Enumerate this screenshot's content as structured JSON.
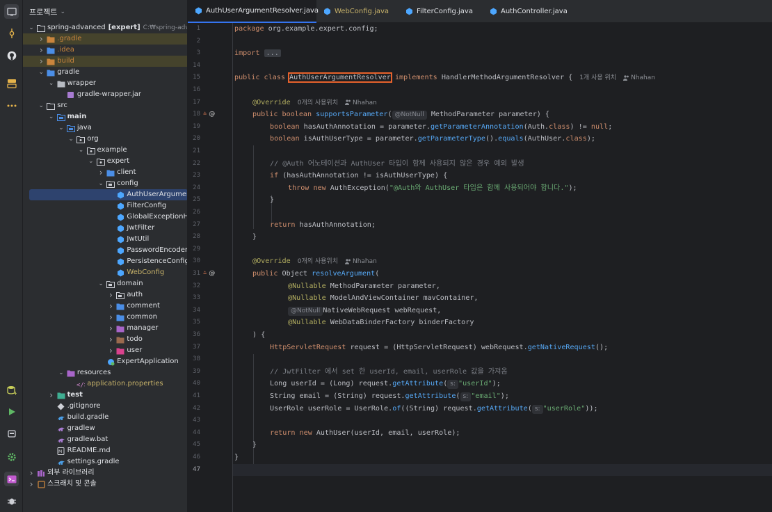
{
  "project_panel": {
    "title": "프로젝트",
    "chevron": "⌄"
  },
  "tree": [
    {
      "label": "spring-advanced",
      "bold_suffix": "[expert]",
      "extra": "C:₩spring-advanced"
    },
    {
      "label": ".gradle"
    },
    {
      "label": ".idea"
    },
    {
      "label": "build"
    },
    {
      "label": "gradle"
    },
    {
      "label": "wrapper"
    },
    {
      "label": "gradle-wrapper.jar"
    },
    {
      "label": "src"
    },
    {
      "label": "main"
    },
    {
      "label": "java"
    },
    {
      "label": "org"
    },
    {
      "label": "example"
    },
    {
      "label": "expert"
    },
    {
      "label": "client"
    },
    {
      "label": "config"
    },
    {
      "label": "AuthUserArgumentResolver"
    },
    {
      "label": "FilterConfig"
    },
    {
      "label": "GlobalExceptionHandler"
    },
    {
      "label": "JwtFilter"
    },
    {
      "label": "JwtUtil"
    },
    {
      "label": "PasswordEncoder"
    },
    {
      "label": "PersistenceConfig"
    },
    {
      "label": "WebConfig"
    },
    {
      "label": "domain"
    },
    {
      "label": "auth"
    },
    {
      "label": "comment"
    },
    {
      "label": "common"
    },
    {
      "label": "manager"
    },
    {
      "label": "todo"
    },
    {
      "label": "user"
    },
    {
      "label": "ExpertApplication"
    },
    {
      "label": "resources"
    },
    {
      "label": "application.properties"
    },
    {
      "label": "test"
    },
    {
      "label": ".gitignore"
    },
    {
      "label": "build.gradle"
    },
    {
      "label": "gradlew"
    },
    {
      "label": "gradlew.bat"
    },
    {
      "label": "README.md"
    },
    {
      "label": "settings.gradle"
    },
    {
      "label": "외부 라이브러리"
    },
    {
      "label": "스크래치 및 콘솔"
    }
  ],
  "tabs": [
    {
      "label": "AuthUserArgumentResolver.java",
      "close": "×"
    },
    {
      "label": "WebConfig.java"
    },
    {
      "label": "FilterConfig.java"
    },
    {
      "label": "AuthController.java"
    }
  ],
  "line_numbers": [
    "1",
    "2",
    "3",
    "14",
    "15",
    "16",
    "17",
    "18",
    "19",
    "20",
    "21",
    "22",
    "23",
    "24",
    "25",
    "26",
    "27",
    "28",
    "29",
    "30",
    "31",
    "32",
    "33",
    "34",
    "35",
    "36",
    "37",
    "38",
    "39",
    "40",
    "41",
    "42",
    "43",
    "44",
    "45",
    "46",
    "47"
  ],
  "gutter_marks": {
    "m18": "⩮",
    "m31": "⩮",
    "at": "@"
  },
  "code": {
    "l1a": "package",
    "l1b": " org.example.expert.config;",
    "l3a": "import",
    "l3b": "...",
    "l3arrow": "›",
    "l15a": "public class ",
    "l15b": "AuthUserArgumentResolver",
    "l15c": " implements ",
    "l15d": "HandlerMethodArgumentResolver {",
    "l15hint": "1개 사용 위치",
    "l15author": "Nhahan",
    "l17a": "@Override",
    "l17hint": "0개의 사용위치",
    "l17author": "Nhahan",
    "l18a": "public boolean ",
    "l18b": "supportsParameter",
    "l18c": "(",
    "l18d": "@NotNull",
    "l18e": " MethodParameter parameter) {",
    "l19a": "boolean ",
    "l19b": "hasAuthAnnotation = parameter.",
    "l19c": "getParameterAnnotation",
    "l19d": "(Auth.",
    "l19e": "class",
    "l19f": ") != ",
    "l19g": "null",
    ";": ";",
    "l20a": "boolean ",
    "l20b": "isAuthUserType = parameter.",
    "l20c": "getParameterType",
    "l20d": "().",
    "l20e": "equals",
    "l20f": "(AuthUser.",
    "l20g": "class",
    "l20h": ");",
    "l22": "// @Auth 어노테이션과 AuthUser 타입이 함께 사용되지 않은 경우 예외 발생",
    "l23a": "if ",
    "l23b": "(hasAuthAnnotation != isAuthUserType) {",
    "l24a": "throw new ",
    "l24b": "AuthException(",
    "l24c": "\"@Auth와 AuthUser 타입은 함께 사용되어야 합니다.\"",
    "l24d": ");",
    "l25": "}",
    "l27a": "return ",
    "l27b": "hasAuthAnnotation;",
    "l28": "}",
    "l30a": "@Override",
    "l30hint": "0개의 사용위치",
    "l30author": "Nhahan",
    "l31a": "public ",
    "l31b": "Object ",
    "l31c": "resolveArgument",
    "l31d": "(",
    "l32a": "@Nullable ",
    "l32b": "MethodParameter parameter,",
    "l33a": "@Nullable ",
    "l33b": "ModelAndViewContainer mavContainer,",
    "l34a": "@NotNull",
    "l34b": "NativeWebRequest webRequest,",
    "l35a": "@Nullable ",
    "l35b": "WebDataBinderFactory binderFactory",
    "l36": ") {",
    "l37a": "HttpServletRequest ",
    "l37b": "request = (HttpServletRequest) webRequest.",
    "l37c": "getNativeRequest",
    "l37d": "();",
    "l39": "// JwtFilter 에서 set 한 userId, email, userRole 값을 가져옴",
    "l40a": "Long ",
    "l40b": "userId = (Long) request.",
    "l40c": "getAttribute",
    "l40d": "(",
    "l40e": "s:",
    "l40f": "\"userId\"",
    "l40g": ");",
    "l41a": "String ",
    "l41b": "email = (String) request.",
    "l41c": "getAttribute",
    "l41d": "(",
    "l41e": "s:",
    "l41f": "\"email\"",
    "l41g": ");",
    "l42a": "UserRole ",
    "l42b": "userRole = UserRole.",
    "l42c": "of",
    "l42d": "((String) request.",
    "l42e": "getAttribute",
    "l42f": "(",
    "l42g": "s:",
    "l42h": "\"userRole\"",
    "l42i": "));",
    "l44a": "return new ",
    "l44b": "AuthUser(userId, email, userRole);",
    "l45": "}",
    "l46": "}"
  },
  "colors": {
    "accent": "#3574f0",
    "highlight_box": "#e8622c",
    "keyword": "#cf8e6d",
    "annotation": "#b3ae60",
    "method": "#56a8f5",
    "string": "#6aab73"
  }
}
